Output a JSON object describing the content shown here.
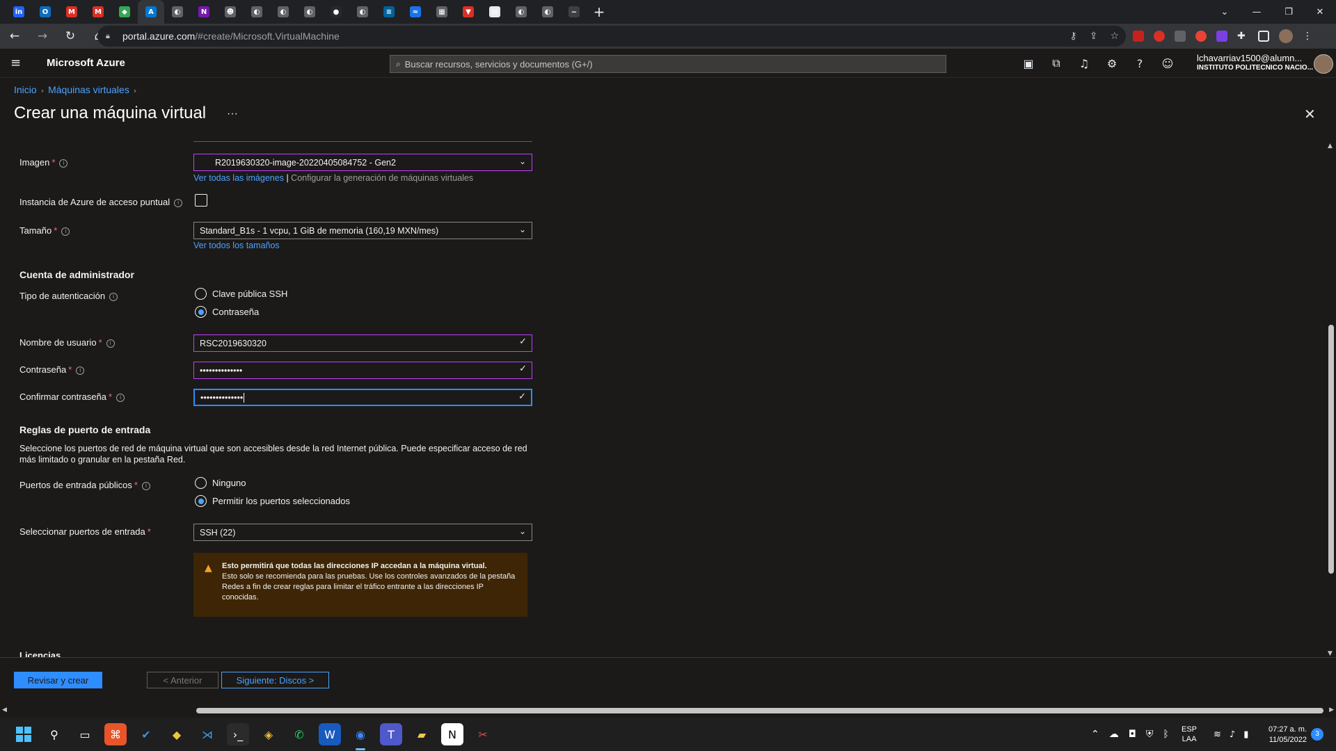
{
  "browser": {
    "tabs": [
      {
        "icon": "indeed-icon",
        "glyph": "in",
        "color": "#2164f3",
        "active": false
      },
      {
        "icon": "outlook-icon",
        "glyph": "O",
        "color": "#0f6cbd",
        "active": false
      },
      {
        "icon": "gmail-icon",
        "glyph": "M",
        "color": "#d93025",
        "active": false
      },
      {
        "icon": "gmail-icon",
        "glyph": "M",
        "color": "#d93025",
        "active": false
      },
      {
        "icon": "app-green-icon",
        "glyph": "◆",
        "color": "#34a853",
        "active": false
      },
      {
        "icon": "azure-icon",
        "glyph": "A",
        "color": "#0078d4",
        "active": true
      },
      {
        "icon": "globe-icon",
        "glyph": "◐",
        "color": "#5f6368",
        "active": false
      },
      {
        "icon": "onenote-icon",
        "glyph": "N",
        "color": "#7719aa",
        "active": false
      },
      {
        "icon": "user-icon",
        "glyph": "☻",
        "color": "#5f6368",
        "active": false
      },
      {
        "icon": "globe-icon",
        "glyph": "◐",
        "color": "#5f6368",
        "active": false
      },
      {
        "icon": "globe-icon",
        "glyph": "◐",
        "color": "#5f6368",
        "active": false
      },
      {
        "icon": "globe-icon",
        "glyph": "◐",
        "color": "#5f6368",
        "active": false
      },
      {
        "icon": "github-icon",
        "glyph": "●",
        "color": "#24292f",
        "active": false
      },
      {
        "icon": "globe-icon",
        "glyph": "◐",
        "color": "#5f6368",
        "active": false
      },
      {
        "icon": "ieee-icon",
        "glyph": "≡",
        "color": "#00629b",
        "active": false
      },
      {
        "icon": "app-blue-icon",
        "glyph": "≈",
        "color": "#1a73e8",
        "active": false
      },
      {
        "icon": "image-icon",
        "glyph": "▦",
        "color": "#5f6368",
        "active": false
      },
      {
        "icon": "shield-icon",
        "glyph": "▼",
        "color": "#d93025",
        "active": false
      },
      {
        "icon": "doc-icon",
        "glyph": "▤",
        "color": "#e8eaed",
        "active": false
      },
      {
        "icon": "globe-icon",
        "glyph": "◐",
        "color": "#5f6368",
        "active": false
      },
      {
        "icon": "globe-icon",
        "glyph": "◐",
        "color": "#5f6368",
        "active": false
      },
      {
        "icon": "wave-icon",
        "glyph": "~",
        "color": "#3c4043",
        "active": false
      }
    ],
    "url_host": "portal.azure.com",
    "url_path": "/#create/Microsoft.VirtualMachine"
  },
  "azure": {
    "brand": "Microsoft Azure",
    "search_placeholder": "Buscar recursos, servicios y documentos (G+/)",
    "account_user": "lchavarriav1500@alumn...",
    "account_org": "INSTITUTO POLITECNICO NACIO..."
  },
  "breadcrumb": {
    "home": "Inicio",
    "vms": "Máquinas virtuales"
  },
  "page": {
    "title": "Crear una máquina virtual",
    "more": "···"
  },
  "form": {
    "image_label": "Imagen",
    "image_value": "R2019630320-image-20220405084752 - Gen2",
    "image_link_all": "Ver todas las imágenes",
    "image_link_sep": "|",
    "image_link_config": "Configurar la generación de máquinas virtuales",
    "spot_label": "Instancia de Azure de acceso puntual",
    "size_label": "Tamaño",
    "size_value": "Standard_B1s - 1 vcpu, 1 GiB de memoria (160,19 MXN/mes)",
    "size_link": "Ver todos los tamaños",
    "admin_section": "Cuenta de administrador",
    "auth_label": "Tipo de autenticación",
    "auth_ssh": "Clave pública SSH",
    "auth_password": "Contraseña",
    "username_label": "Nombre de usuario",
    "username_value": "RSC2019630320",
    "password_label": "Contraseña",
    "password_value": "••••••••••••••",
    "confirm_label": "Confirmar contraseña",
    "confirm_value": "••••••••••••••",
    "inbound_section": "Reglas de puerto de entrada",
    "inbound_desc": "Seleccione los puertos de red de máquina virtual que son accesibles desde la red Internet pública. Puede especificar acceso de red más limitado o granular en la pestaña Red.",
    "public_ports_label": "Puertos de entrada públicos",
    "ports_none": "Ninguno",
    "ports_allow": "Permitir los puertos seleccionados",
    "select_ports_label": "Seleccionar puertos de entrada",
    "select_ports_value": "SSH (22)",
    "warning_bold": "Esto permitirá que todas las direcciones IP accedan a la máquina virtual.",
    "warning_text": "Esto solo se recomienda para las pruebas.  Use los controles avanzados de la pestaña Redes a fin de crear reglas para limitar el tráfico entrante a las direcciones IP conocidas.",
    "licenses_partial": "Licencias"
  },
  "footer": {
    "review": "Revisar y crear",
    "prev": "< Anterior",
    "next": "Siguiente: Discos >"
  },
  "taskbar": {
    "lang_top": "ESP",
    "lang_bottom": "LAA",
    "time": "07:27 a. m.",
    "date": "11/05/2022",
    "notifications": "3"
  }
}
